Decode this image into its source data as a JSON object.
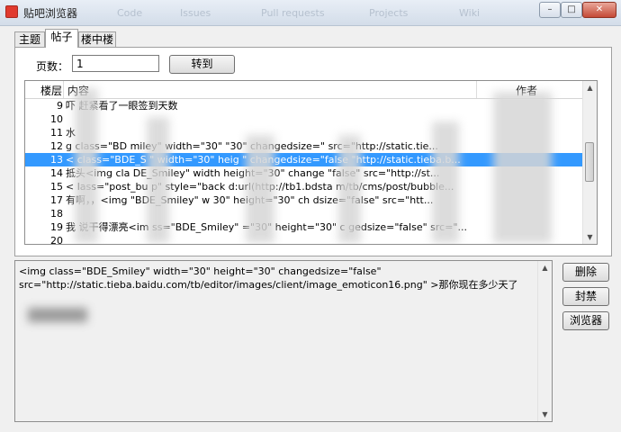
{
  "window": {
    "title": "贴吧浏览器",
    "controls": {
      "minimize": "–",
      "maximize": "□",
      "close": "✕"
    }
  },
  "background_ghost_text": [
    "Code",
    "Issues",
    "Pull requests",
    "Projects",
    "Wiki"
  ],
  "tabs": [
    {
      "label": "主题"
    },
    {
      "label": "帖子"
    },
    {
      "label": "楼中楼"
    }
  ],
  "active_tab": "帖子",
  "pager": {
    "label": "页数：",
    "value": "1",
    "go_button": "转到"
  },
  "list": {
    "columns": [
      "楼层",
      "内容",
      "作者"
    ],
    "rows": [
      {
        "floor": "9",
        "content": "吓  赶紧看了一眼签到天数",
        "author": ""
      },
      {
        "floor": "10",
        "content": "",
        "author": ""
      },
      {
        "floor": "11",
        "content": "    水",
        "author": ""
      },
      {
        "floor": "12",
        "content": "    g class=\"BD     miley\" width=\"30\"      \"30\" changedsize=\"     src=\"http://static.tie...",
        "author": ""
      },
      {
        "floor": "13",
        "content": "<     class=\"BDE_S     \" width=\"30\" heig       \" changedsize=\"false      \"http://static.tieba.b...",
        "author": ""
      },
      {
        "floor": "14",
        "content": "    抵头<img cla     DE_Smiley\" width      height=\"30\" change      \"false\" src=\"http://st...",
        "author": ""
      },
      {
        "floor": "15",
        "content": "<    lass=\"post_bu     p\"    style=\"back      d:url(http://tb1.bdsta     m/tb/cms/post/bubble...",
        "author": ""
      },
      {
        "floor": "17",
        "content": "    有啊，，<img     \"BDE_Smiley\" w     30\" height=\"30\" ch     dsize=\"false\" src=\"htt...",
        "author": ""
      },
      {
        "floor": "18",
        "content": "",
        "author": ""
      },
      {
        "floor": "19",
        "content": "我    说干得漂亮<im     ss=\"BDE_Smiley\"     =\"30\" height=\"30\" c     gedsize=\"false\" src=\"...",
        "author": ""
      },
      {
        "floor": "20",
        "content": "",
        "author": ""
      }
    ],
    "selected_floor": "13"
  },
  "detail": {
    "text": "<img class=\"BDE_Smiley\" width=\"30\" height=\"30\" changedsize=\"false\"\nsrc=\"http://static.tieba.baidu.com/tb/editor/images/client/image_emoticon16.png\" >那你现在多少天了"
  },
  "side_buttons": {
    "delete": "删除",
    "ban": "封禁",
    "browser": "浏览器"
  },
  "colors": {
    "selection": "#3399ff",
    "window_bg": "#f0f0f0",
    "close_button": "#c44a36"
  },
  "icons": {
    "app": "tieba-app-icon",
    "scroll_up": "scroll-up-arrow-icon",
    "scroll_down": "scroll-down-arrow-icon"
  }
}
